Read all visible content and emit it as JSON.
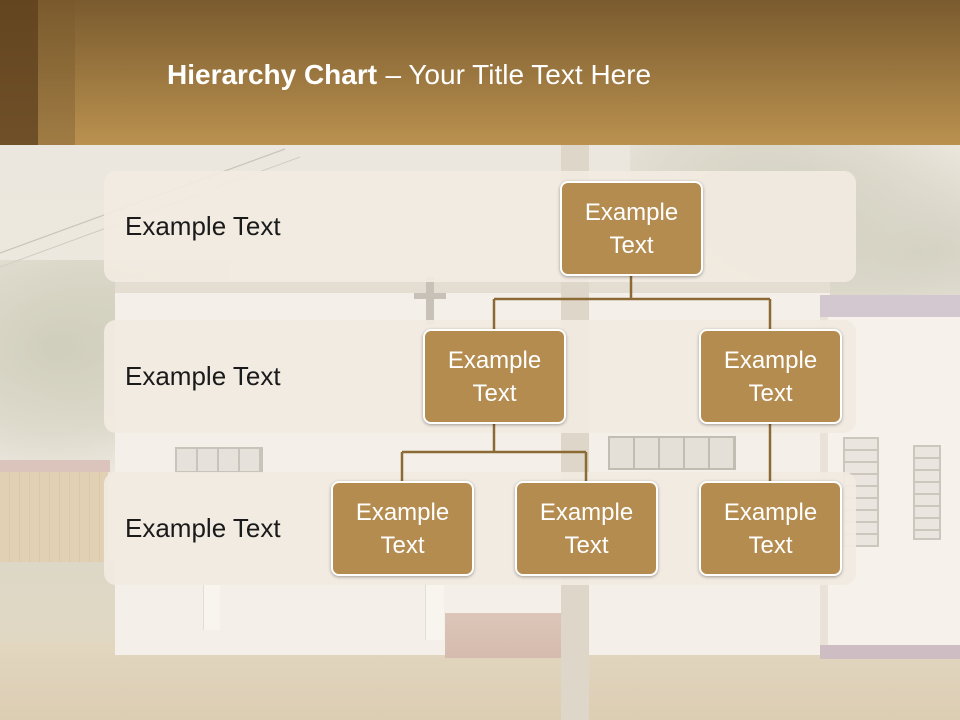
{
  "title": {
    "bold": "Hierarchy Chart",
    "regular": "– Your Title Text Here"
  },
  "row_labels": [
    "Example Text",
    "Example Text",
    "Example Text"
  ],
  "tree": {
    "label": "Example Text",
    "children": [
      {
        "label": "Example Text",
        "children": [
          {
            "label": "Example Text"
          },
          {
            "label": "Example Text"
          }
        ]
      },
      {
        "label": "Example Text",
        "children": [
          {
            "label": "Example Text"
          }
        ]
      }
    ]
  },
  "colors": {
    "header_top": "#7a5b2f",
    "header_bottom": "#ba914f",
    "node_fill": "#b48c4f",
    "connector": "#8c6a36",
    "label_text": "#1a1a1a"
  }
}
